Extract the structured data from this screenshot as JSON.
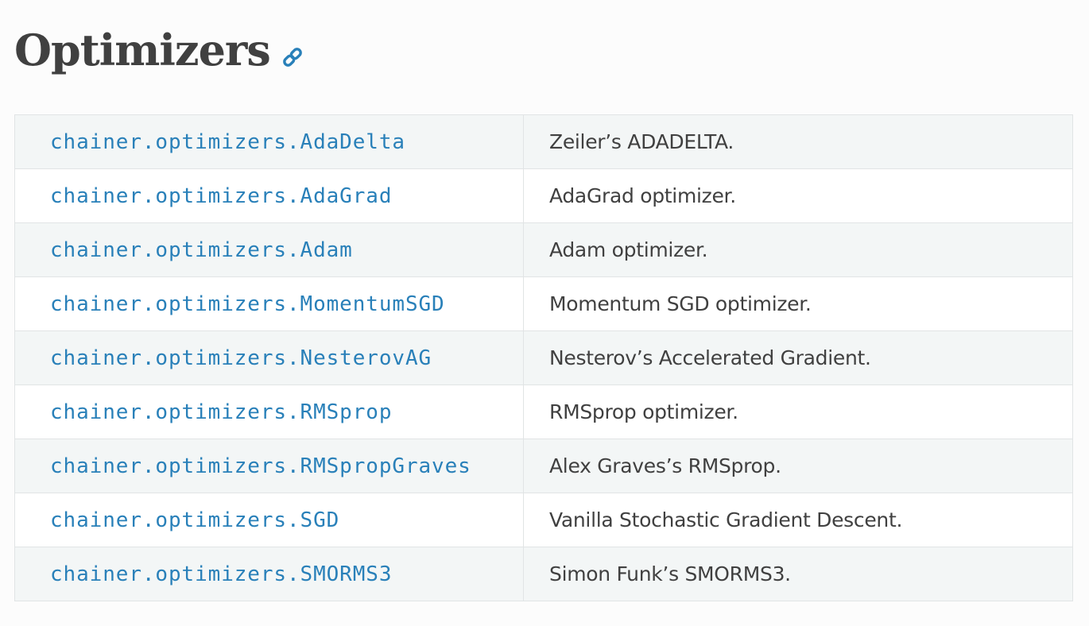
{
  "page": {
    "title": "Optimizers",
    "link_icon": "link-icon"
  },
  "colors": {
    "link": "#2980b9",
    "text": "#404040",
    "row_odd": "#f3f6f6",
    "row_even": "#ffffff",
    "border": "#e1e4e5"
  },
  "table": {
    "rows": [
      {
        "name": "chainer.optimizers.AdaDelta",
        "description": "Zeiler’s ADADELTA."
      },
      {
        "name": "chainer.optimizers.AdaGrad",
        "description": "AdaGrad optimizer."
      },
      {
        "name": "chainer.optimizers.Adam",
        "description": "Adam optimizer."
      },
      {
        "name": "chainer.optimizers.MomentumSGD",
        "description": "Momentum SGD optimizer."
      },
      {
        "name": "chainer.optimizers.NesterovAG",
        "description": "Nesterov’s Accelerated Gradient."
      },
      {
        "name": "chainer.optimizers.RMSprop",
        "description": "RMSprop optimizer."
      },
      {
        "name": "chainer.optimizers.RMSpropGraves",
        "description": "Alex Graves’s RMSprop."
      },
      {
        "name": "chainer.optimizers.SGD",
        "description": "Vanilla Stochastic Gradient Descent."
      },
      {
        "name": "chainer.optimizers.SMORMS3",
        "description": "Simon Funk’s SMORMS3."
      }
    ]
  }
}
